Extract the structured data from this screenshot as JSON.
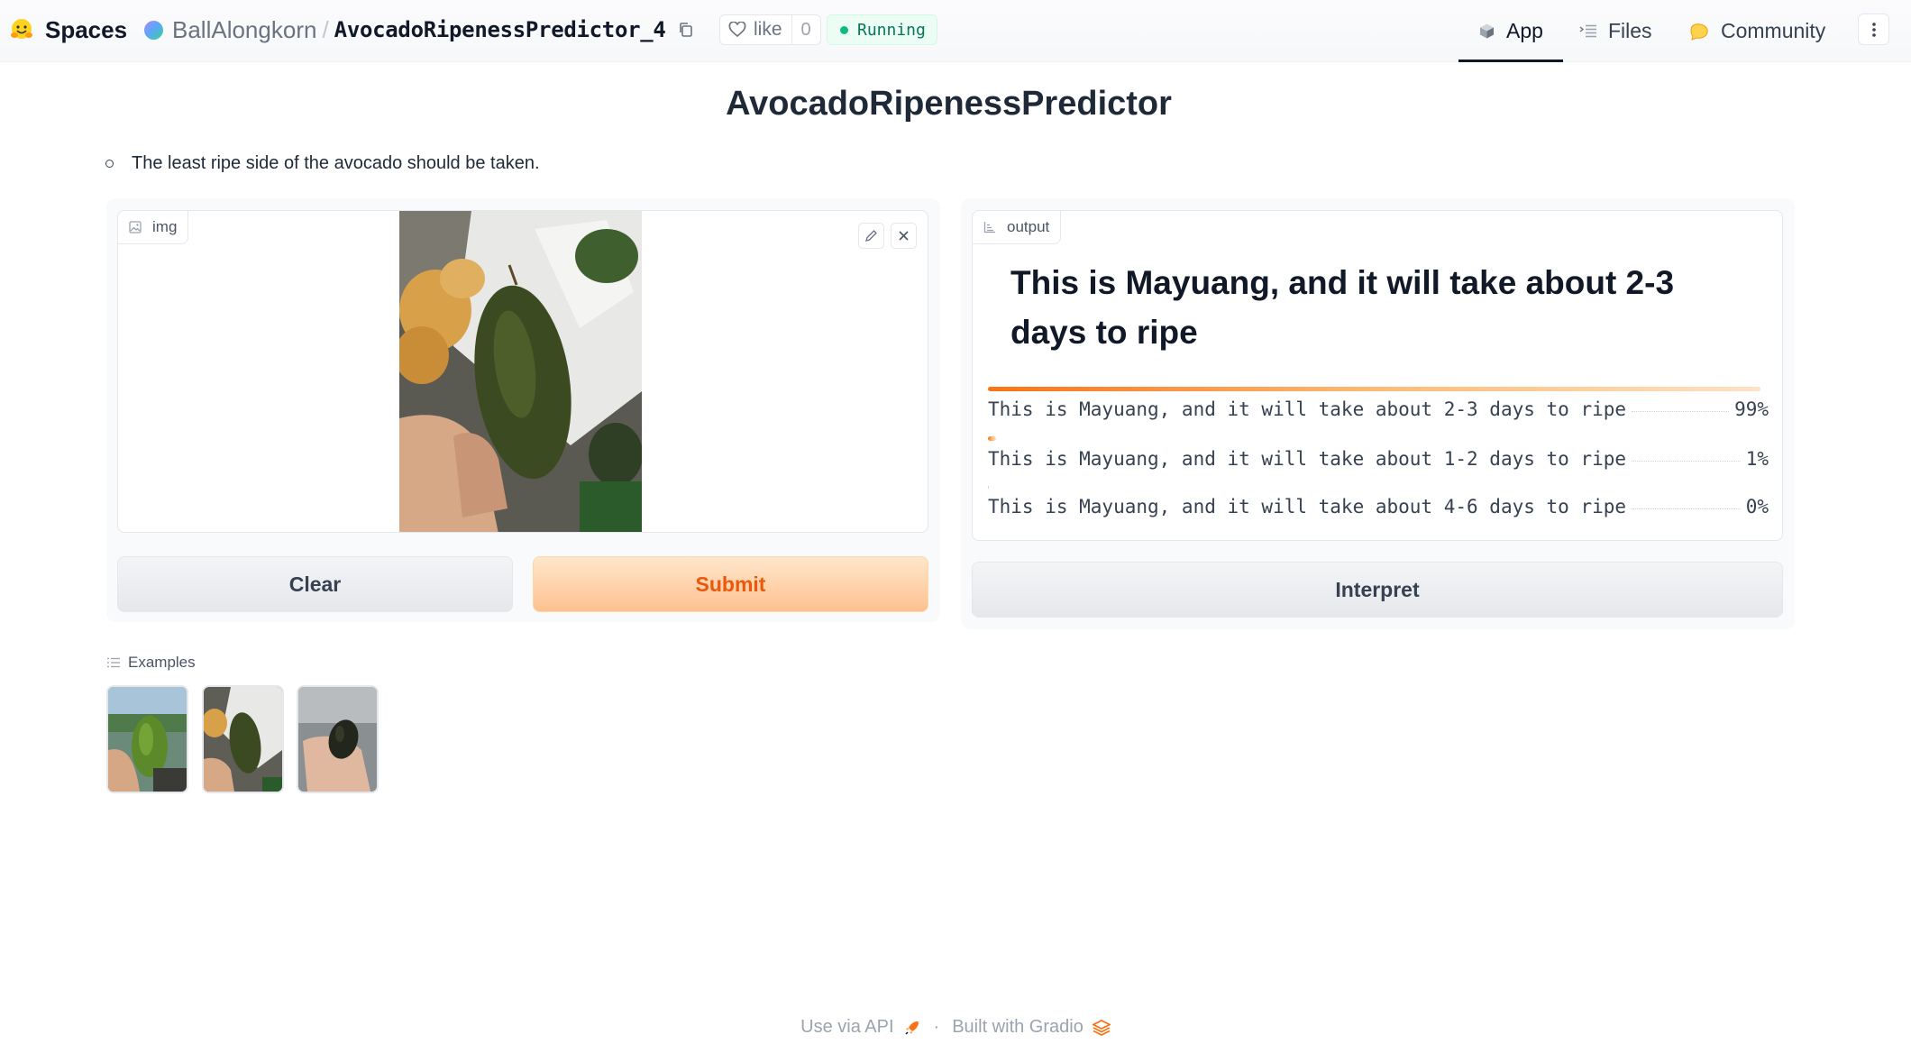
{
  "header": {
    "brand": "Spaces",
    "owner": "BallAlongkorn",
    "separator": "/",
    "repo": "AvocadoRipenessPredictor_4",
    "like_label": "like",
    "like_count": "0",
    "status": "Running",
    "nav": {
      "app": "App",
      "files": "Files",
      "community": "Community"
    }
  },
  "page": {
    "title": "AvocadoRipenessPredictor",
    "description": "The least ripe side of the avocado should be taken."
  },
  "input": {
    "label": "img",
    "clear_label": "Clear",
    "submit_label": "Submit"
  },
  "output": {
    "label": "output",
    "headline": "This is Mayuang, and it will take about 2-3 days to ripe",
    "confidences": [
      {
        "label": "This is Mayuang, and it will take about 2-3 days to ripe",
        "value": 0.99,
        "display": "99%"
      },
      {
        "label": "This is Mayuang, and it will take about 1-2 days to ripe",
        "value": 0.01,
        "display": "1%"
      },
      {
        "label": "This is Mayuang, and it will take about 4-6 days to ripe",
        "value": 0.0,
        "display": "0%"
      }
    ],
    "interpret_label": "Interpret"
  },
  "examples": {
    "label": "Examples",
    "count": 3
  },
  "footer": {
    "api_label": "Use via API",
    "dot": "·",
    "built_label": "Built with Gradio"
  },
  "colors": {
    "accent": "#f97316",
    "submit_text": "#ea580c",
    "running": "#10b981"
  }
}
